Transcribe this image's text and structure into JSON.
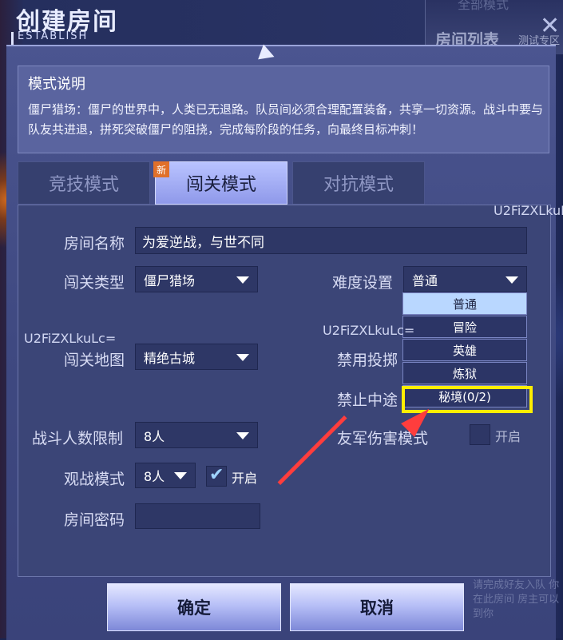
{
  "header": {
    "title": "创建房间",
    "subtitle": "ESTABLISH"
  },
  "background": {
    "title": "房间列表",
    "subtitle": "测试专区",
    "ghost_text": "全部模式",
    "bottom_ghost": "请完成好友入队\n你在此房间\n房主可以到你"
  },
  "mode_description": {
    "title": "模式说明",
    "text": "僵尸猎场：僵尸的世界中，人类已无退路。队员间必须合理配置装备，共享一切资源。战斗中要与队友共进退，拼死突破僵尸的阻挠，完成每阶段的任务，向最终目标冲刺！"
  },
  "tabs": [
    {
      "label": "竞技模式",
      "active": false
    },
    {
      "label": "闯关模式",
      "active": true
    },
    {
      "label": "对抗模式",
      "active": false
    }
  ],
  "new_badge": "新",
  "form": {
    "room_name_label": "房间名称",
    "room_name_value": "为爱逆战，与世不同",
    "level_type_label": "闯关类型",
    "level_type_value": "僵尸猎场",
    "difficulty_label": "难度设置",
    "difficulty_value": "普通",
    "map_label": "闯关地图",
    "map_value": "精绝古城",
    "ban_throw_label": "禁用投掷",
    "ban_midway_label": "禁止中途",
    "player_limit_label": "战斗人数限制",
    "player_limit_value": "8人",
    "friendly_fire_label": "友军伤害模式",
    "friendly_fire_check_label": "开启",
    "spectate_label": "观战模式",
    "spectate_value": "8人",
    "spectate_check_label": "开启",
    "password_label": "房间密码",
    "password_value": ""
  },
  "difficulty_options": [
    "普通",
    "冒险",
    "英雄",
    "炼狱",
    "秘境(0/2)"
  ],
  "difficulty_selected_index": 0,
  "difficulty_highlighted_index": 4,
  "checkbox_state": {
    "spectate": true,
    "friendly_fire": false
  },
  "watermark": "U2FiZXLkuLc=",
  "buttons": {
    "confirm": "确定",
    "cancel": "取消"
  },
  "colors": {
    "accent": "#8f99ea",
    "highlight_box": "#ffee00",
    "annotation_arrow": "#ff3d3d",
    "selected_option": "#b9d7ff"
  }
}
